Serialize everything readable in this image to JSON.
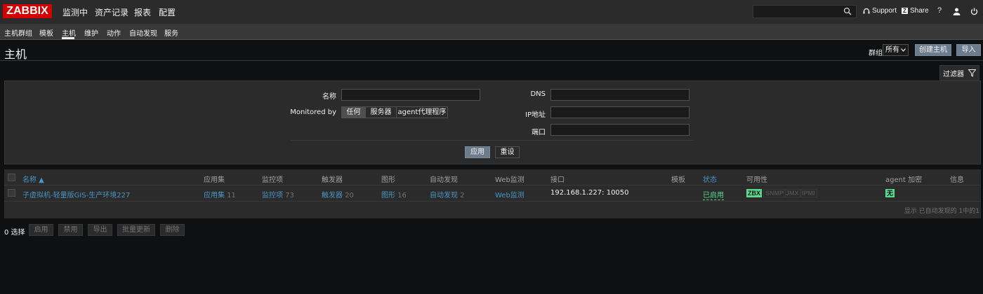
{
  "logo": "ZABBIX",
  "top_menu": [
    "监测中",
    "资产记录",
    "报表",
    "配置"
  ],
  "header_right": {
    "support": "Support",
    "share": "Share",
    "help": "?"
  },
  "sub_menu": [
    "主机群组",
    "模板",
    "主机",
    "维护",
    "动作",
    "自动发现",
    "服务"
  ],
  "page_title": "主机",
  "group_filter": {
    "label": "群组",
    "value": "所有"
  },
  "buttons": {
    "create": "创建主机",
    "import": "导入"
  },
  "filter": {
    "tab_label": "过滤器",
    "name_label": "名称",
    "monitored_by_label": "Monitored by",
    "monitored_by_options": [
      "任何",
      "服务器",
      "agent代理程序"
    ],
    "dns_label": "DNS",
    "ip_label": "IP地址",
    "port_label": "端口",
    "apply": "应用",
    "reset": "重设"
  },
  "table": {
    "columns": [
      "名称 ▲",
      "应用集",
      "监控项",
      "触发器",
      "图形",
      "自动发现",
      "Web监测",
      "接口",
      "模板",
      "状态",
      "可用性",
      "agent 加密",
      "信息"
    ],
    "rows": [
      {
        "name": "子虚拟机-轻量版GIS-生产环境227",
        "applications": "应用集",
        "applications_count": "11",
        "items": "监控项",
        "items_count": "73",
        "triggers": "触发器",
        "triggers_count": "20",
        "graphs": "图形",
        "graphs_count": "16",
        "discovery": "自动发现",
        "discovery_count": "2",
        "web": "Web监测",
        "interface": "192.168.1.227: 10050",
        "template": "",
        "status": "已启用",
        "availability": [
          "ZBX",
          "SNMP",
          "JMX",
          "IPMI"
        ],
        "encryption": "无"
      }
    ],
    "footer": "显示 已自动发现的 1中的1"
  },
  "bottom": {
    "selected": "0 选择",
    "actions": [
      "启用",
      "禁用",
      "导出",
      "批量更新",
      "删除"
    ]
  },
  "colors": {
    "brand": "#d40000",
    "link": "#4796c4",
    "enabled": "#59db8f"
  }
}
